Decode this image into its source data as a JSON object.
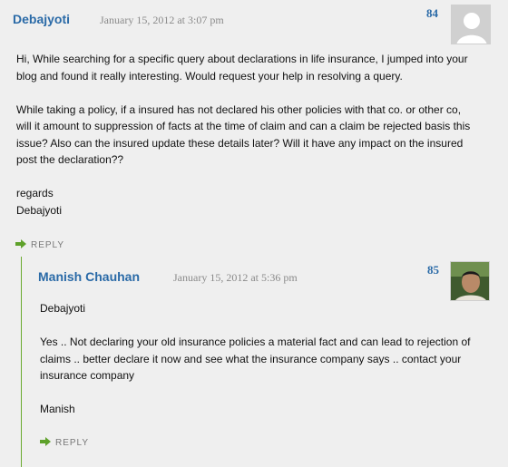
{
  "comments": [
    {
      "author": "Debajyoti",
      "date": "January 15, 2012 at 3:07 pm",
      "number": "84",
      "paragraphs": [
        "Hi, While searching for a specific query about declarations in life insurance, I jumped into your blog and found it really interesting. Would request your help in resolving a query.",
        "While taking a policy, if a insured has not declared his other policies with that co. or other co, will it amount to suppression of facts at the time of claim and can a claim be rejected basis this issue? Also can the insured update these details later? Will it have any impact on the insured post the declaration??"
      ],
      "signoff": [
        "regards",
        "Debajyoti"
      ],
      "reply_label": "REPLY"
    },
    {
      "author": "Manish Chauhan",
      "date": "January 15, 2012 at 5:36 pm",
      "number": "85",
      "paragraphs": [
        "Debajyoti",
        "Yes .. Not declaring your old insurance policies a material fact and can lead to rejection of claims .. better declare it now and see what the insurance company says .. contact your insurance company",
        "Manish"
      ],
      "reply_label": "REPLY"
    }
  ],
  "icons": {
    "reply": "reply-arrow-icon",
    "avatar_default": "default-avatar-icon",
    "avatar_photo": "user-photo-avatar"
  },
  "colors": {
    "author": "#2a6aa7",
    "date": "#8a8a8a",
    "accent_green": "#6aaa2f",
    "background": "#efefef"
  }
}
